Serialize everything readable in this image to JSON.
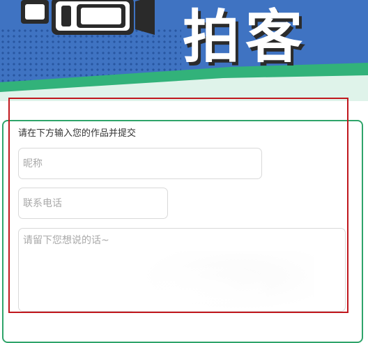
{
  "banner": {
    "title": "拍客",
    "camera_icon": "video-camera-icon",
    "colors": {
      "blue": "#3f73c2",
      "green": "#32b27a",
      "mint": "#dff3ea"
    }
  },
  "form": {
    "prompt": "请在下方输入您的作品并提交",
    "nickname_placeholder": "昵称",
    "phone_placeholder": "联系电话",
    "message_placeholder": "请留下您想说的话~",
    "border_color": "#2fa46a"
  },
  "highlight": {
    "color": "#c0171d"
  }
}
